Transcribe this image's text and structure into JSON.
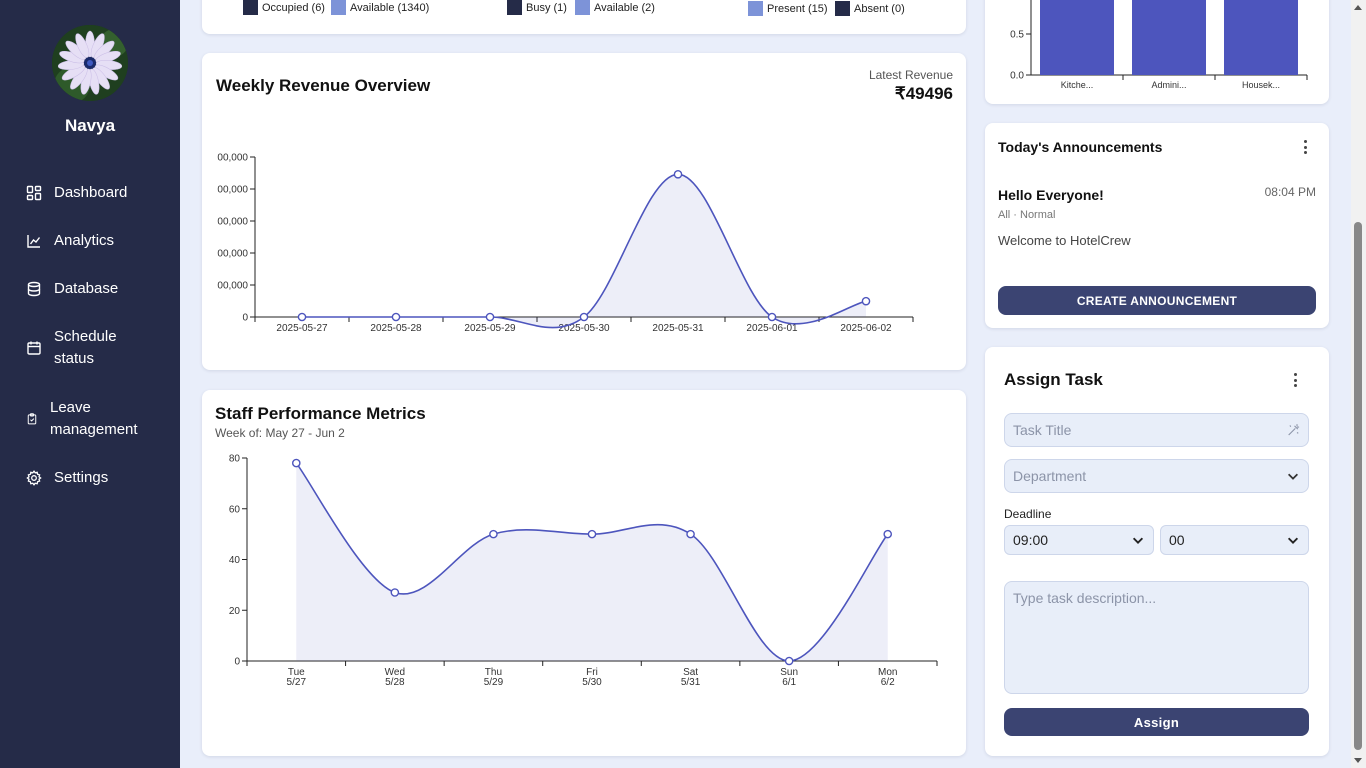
{
  "user": {
    "name": "Navya"
  },
  "nav": {
    "dashboard": "Dashboard",
    "analytics": "Analytics",
    "database": "Database",
    "schedule_l1": "Schedule",
    "schedule_l2": "status",
    "leave_l1": "Leave",
    "leave_l2": "management",
    "settings": "Settings"
  },
  "top_legends": {
    "occupied": "Occupied (6)",
    "available_rooms": "Available (1340)",
    "busy": "Busy (1)",
    "available_staff": "Available (2)",
    "present": "Present (15)",
    "absent": "Absent (0)"
  },
  "dept_chart": {
    "y_ticks": [
      "0.5",
      "0.0"
    ],
    "categories": [
      "Kitche...",
      "Admini...",
      "Housek..."
    ]
  },
  "revenue": {
    "title": "Weekly Revenue Overview",
    "latest_label": "Latest Revenue",
    "latest_value": "₹49496"
  },
  "performance": {
    "title": "Staff Performance Metrics",
    "subtitle": "Week of: May 27 - Jun 2"
  },
  "announcements": {
    "title": "Today's Announcements",
    "item_title": "Hello Everyone!",
    "item_time": "08:04 PM",
    "item_meta": "All · Normal",
    "item_body": "Welcome to HotelCrew",
    "create_button": "CREATE ANNOUNCEMENT"
  },
  "assign_task": {
    "title": "Assign Task",
    "task_title_placeholder": "Task Title",
    "department_placeholder": "Department",
    "deadline_label": "Deadline",
    "hour_value": "09:00",
    "minute_value": "00",
    "description_placeholder": "Type task description...",
    "assign_button": "Assign"
  },
  "colors": {
    "sidebar_bg": "#252b48",
    "accent": "#4d55bd",
    "page_bg": "#e9eefa",
    "button_bg": "#3b4472",
    "legend_dark": "#252b48",
    "legend_light": "#7d93d8"
  },
  "chart_data": [
    {
      "type": "area",
      "id": "revenue",
      "x": [
        "2025-05-27",
        "2025-05-28",
        "2025-05-29",
        "2025-05-30",
        "2025-05-31",
        "2025-06-01",
        "2025-06-02"
      ],
      "series": [
        {
          "values": [
            0,
            0,
            0,
            0,
            446000,
            0,
            49496
          ]
        }
      ],
      "y_ticks": [
        "0",
        "00,000",
        "00,000",
        "00,000",
        "00,000",
        "00,000"
      ],
      "ylim": [
        0,
        500000
      ],
      "title": "Weekly Revenue Overview"
    },
    {
      "type": "area",
      "id": "performance",
      "x": [
        "Tue",
        "Wed",
        "Thu",
        "Fri",
        "Sat",
        "Sun",
        "Mon"
      ],
      "x_sub": [
        "5/27",
        "5/28",
        "5/29",
        "5/30",
        "5/31",
        "6/1",
        "6/2"
      ],
      "series": [
        {
          "values": [
            78,
            27,
            50,
            50,
            50,
            0,
            50
          ]
        }
      ],
      "y_ticks": [
        "80",
        "60",
        "40",
        "20",
        "0"
      ],
      "ylim": [
        0,
        80
      ],
      "title": "Staff Performance Metrics"
    },
    {
      "type": "bar",
      "id": "departments",
      "categories": [
        "Kitche...",
        "Admini...",
        "Housek..."
      ],
      "values": [
        1,
        1,
        1
      ],
      "y_ticks": [
        "0.5",
        "0.0"
      ]
    }
  ]
}
